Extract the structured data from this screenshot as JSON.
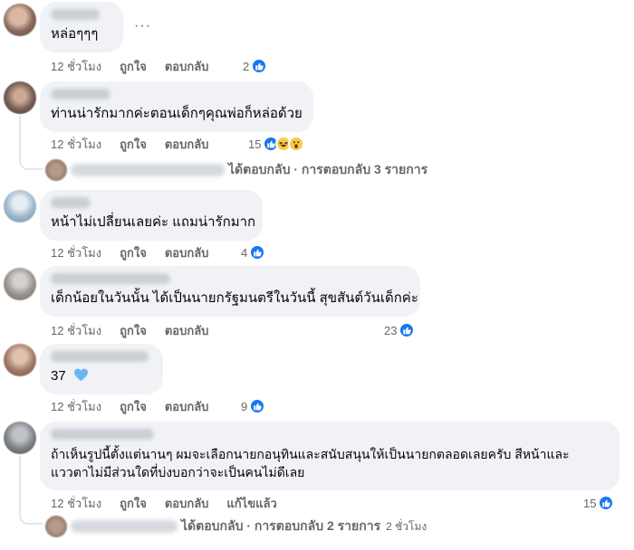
{
  "comments": [
    {
      "text": "หล่อๆๆๆ",
      "more": "···",
      "time": "12 ชั่วโมง",
      "like": "ถูกใจ",
      "reply": "ตอบกลับ",
      "reaction_count": "2",
      "reactions": [
        "like-icon"
      ]
    },
    {
      "text": "ท่านน่ารักมากค่ะตอนเด็กๆคุณพ่อก็หล่อด้วย",
      "time": "12 ชั่วโมง",
      "like": "ถูกใจ",
      "reply": "ตอบกลับ",
      "reaction_count": "15",
      "reactions": [
        "like-icon",
        "haha-icon",
        "wow-icon"
      ],
      "replies_text": "ได้ตอบกลับ · การตอบกลับ 3 รายการ"
    },
    {
      "text": "หน้าไม่เปลี่ยนเลยค่ะ แถมน่ารักมาก",
      "time": "12 ชั่วโมง",
      "like": "ถูกใจ",
      "reply": "ตอบกลับ",
      "reaction_count": "4",
      "reactions": [
        "like-icon"
      ]
    },
    {
      "text": "เด็กน้อยในวันนั้น ได้เป็นนายกรัฐมนตรีในวันนี้ สุขสันต์วันเด็กค่ะ",
      "time": "12 ชั่วโมง",
      "like": "ถูกใจ",
      "reply": "ตอบกลับ",
      "reaction_count": "23",
      "reactions": [
        "like-icon"
      ]
    },
    {
      "text": "37",
      "emoji": "blue-heart-icon",
      "time": "12 ชั่วโมง",
      "like": "ถูกใจ",
      "reply": "ตอบกลับ",
      "reaction_count": "9",
      "reactions": [
        "like-icon"
      ]
    },
    {
      "text_line1": "ถ้าเห็นรูปนี้ตั้งแต่นานๆ ผมจะเลือกนายกอนุทินและสนับสนุนให้เป็นนายกตลอดเลยครับ สีหน้าและ",
      "text_line2": "แววตาไม่มีส่วนใดที่บ่งบอกว่าจะเป็นคนไม่ดีเลย",
      "time": "12 ชั่วโมง",
      "like": "ถูกใจ",
      "reply": "ตอบกลับ",
      "edited": "แก้ไขแล้ว",
      "reaction_count": "15",
      "reactions": [
        "like-icon"
      ],
      "replies_text": "ได้ตอบกลับ · การตอบกลับ 2 รายการ",
      "replies_time": "2 ชั่วโมง"
    }
  ],
  "colors": {
    "bubble": "#f0f2f5",
    "meta": "#65676b",
    "like_blue": "#1877f2"
  }
}
